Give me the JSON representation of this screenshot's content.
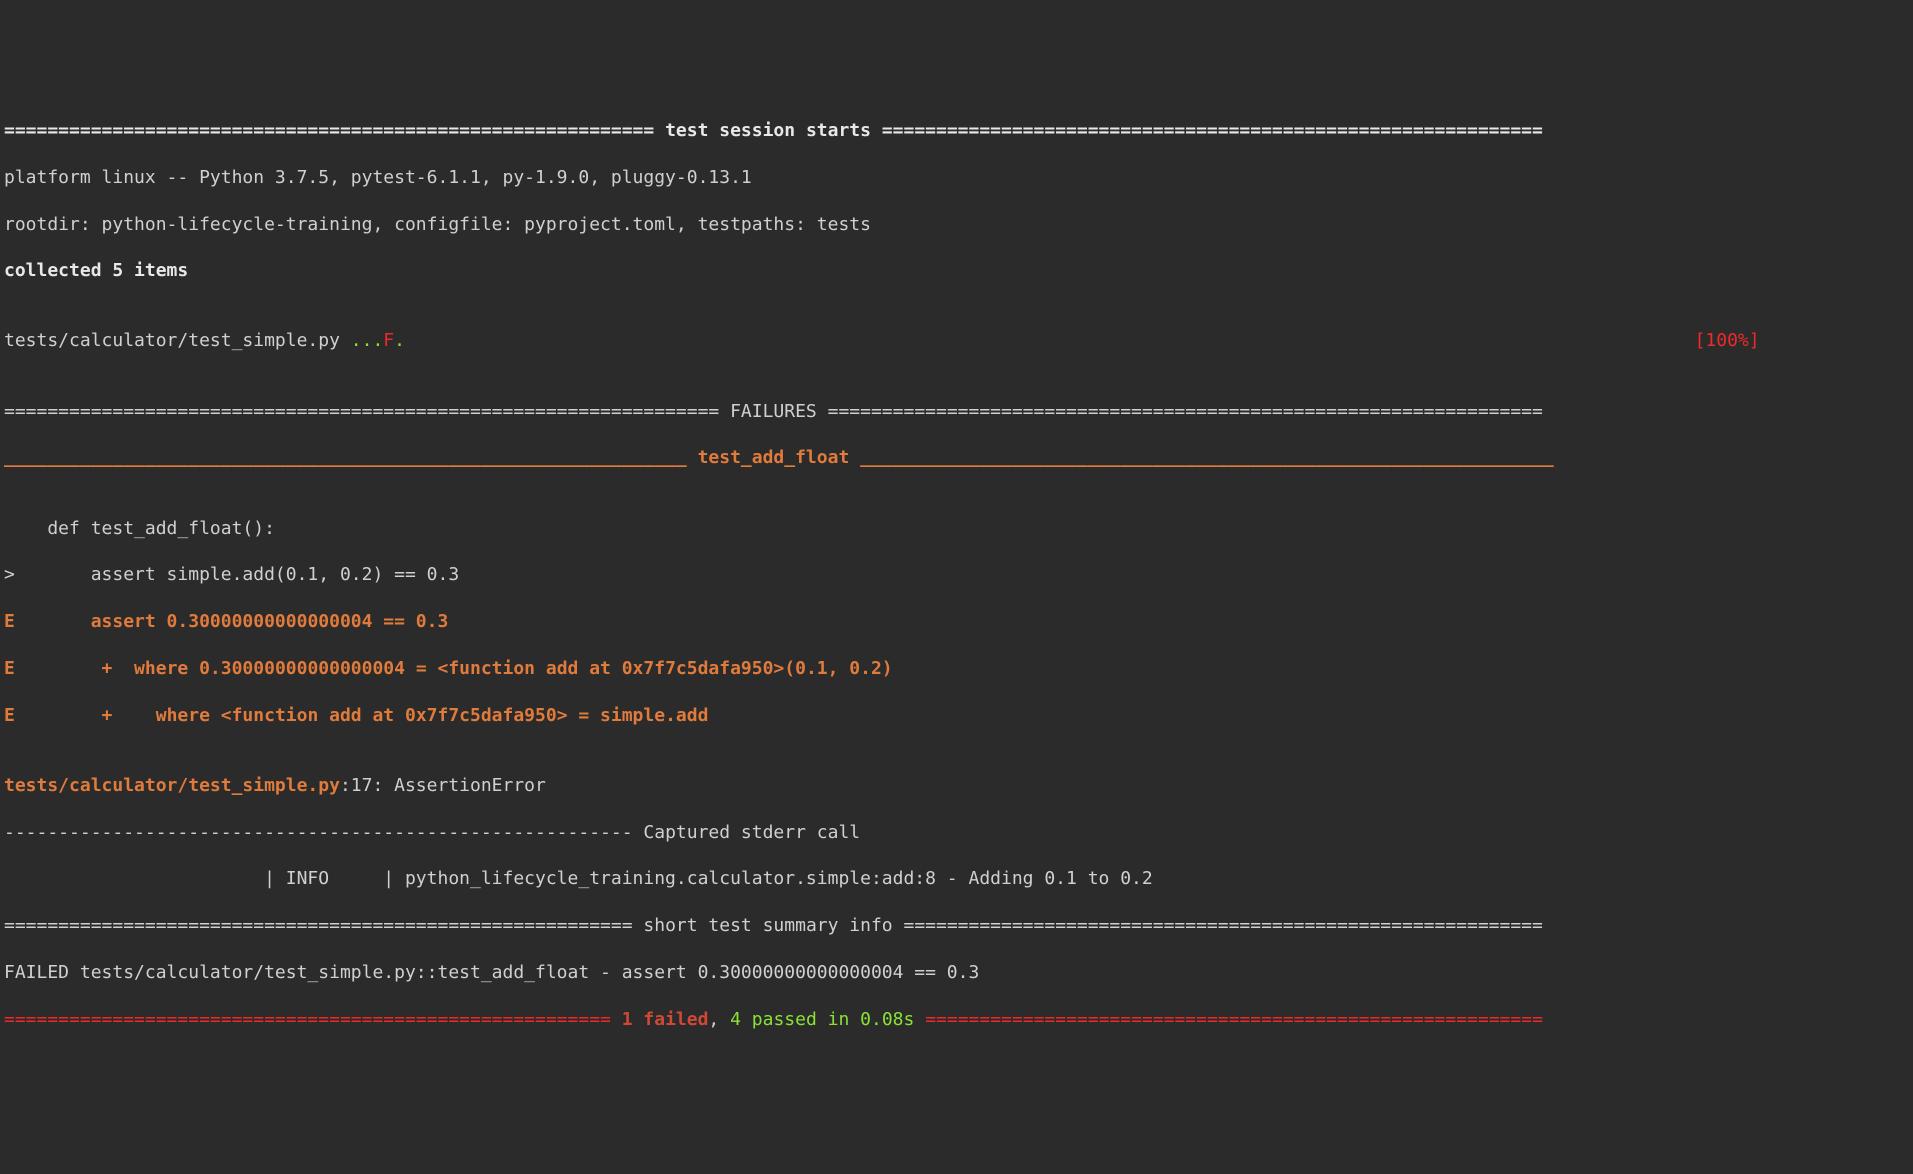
{
  "session_header": {
    "rule_left": "============================================================ ",
    "title": "test session starts",
    "rule_right": " ============================================================="
  },
  "platform_line": "platform linux -- Python 3.7.5, pytest-6.1.1, py-1.9.0, pluggy-0.13.1",
  "rootdir_line": "rootdir: python-lifecycle-training, configfile: pyproject.toml, testpaths: tests",
  "collected_line": "collected 5 items",
  "blank": "",
  "test_file_line": {
    "path": "tests/calculator/test_simple.py ",
    "dots_before": "...",
    "fail_mark": "F",
    "dots_after": ".",
    "padding": "                                                                                                                       ",
    "percent": "[100%]"
  },
  "failures_header": {
    "rule_left": "================================================================== ",
    "title": "FAILURES",
    "rule_right": " =================================================================="
  },
  "test_name_header": {
    "rule_left": "_______________________________________________________________ ",
    "title": "test_add_float",
    "rule_right": " ________________________________________________________________"
  },
  "code_lines": {
    "def_line": "    def test_add_float():",
    "assert_line": ">       assert simple.add(0.1, 0.2) == 0.3",
    "error1_prefix": "E       ",
    "error1_text": "assert 0.30000000000000004 == 0.3",
    "error2_prefix": "E        ",
    "error2_text": "+  where 0.30000000000000004 = <function add at 0x7f7c5dafa950>(0.1, 0.2)",
    "error3_prefix": "E        ",
    "error3_text": "+    where <function add at 0x7f7c5dafa950> = simple.add"
  },
  "location_line": {
    "path": "tests/calculator/test_simple.py",
    "suffix": ":17: AssertionError"
  },
  "captured_header": {
    "rule_left": "---------------------------------------------------------- ",
    "title": "Captured stderr call",
    "rule_right": " -----------------------------------------------------------"
  },
  "log_line": "                        | INFO     | python_lifecycle_training.calculator.simple:add:8 - Adding 0.1 to 0.2",
  "summary_header": {
    "rule_left": "========================================================== ",
    "title": "short test summary info",
    "rule_right": " ==========================================================="
  },
  "failed_line": "FAILED tests/calculator/test_simple.py::test_add_float - assert 0.30000000000000004 == 0.3",
  "final_line": {
    "rule_left": "======================================================== ",
    "failed": "1 failed",
    "comma": ", ",
    "passed": "4 passed",
    "in_label": " in ",
    "duration": "0.08s",
    "rule_right": " ========================================================="
  }
}
